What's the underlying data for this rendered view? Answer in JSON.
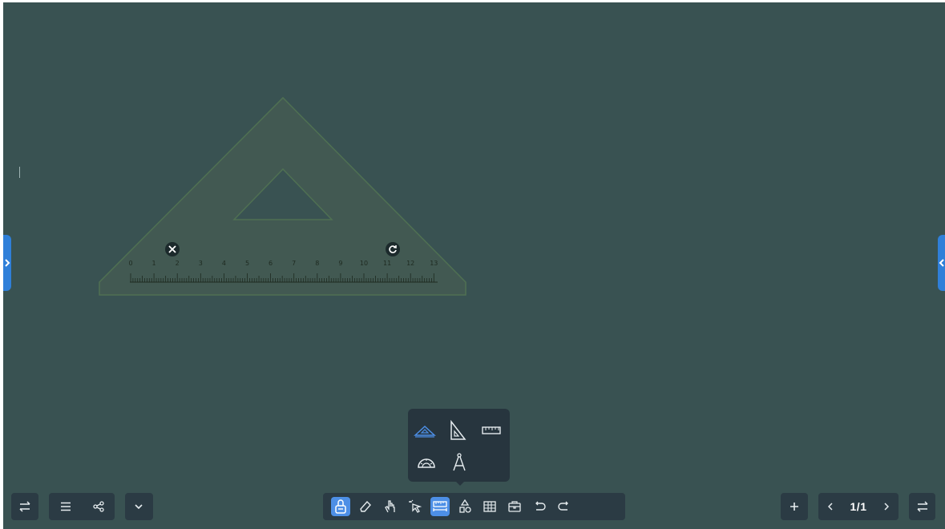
{
  "canvas": {
    "background": "#395252",
    "edge_tab_color": "#2f7fd9"
  },
  "set_square": {
    "ruler_labels": [
      "0",
      "1",
      "2",
      "3",
      "4",
      "5",
      "6",
      "7",
      "8",
      "9",
      "10",
      "11",
      "12",
      "13"
    ],
    "close_icon": "close-icon",
    "rotate_icon": "rotate-icon"
  },
  "toolbar_left": {
    "icons": [
      "swap-icon",
      "menu-icon",
      "share-icon",
      "chevron-down-icon"
    ]
  },
  "toolbar_center": {
    "tools": [
      {
        "name": "pen-tool",
        "active": true
      },
      {
        "name": "eraser-tool",
        "active": false
      },
      {
        "name": "hand-tool",
        "active": false
      },
      {
        "name": "select-tool",
        "active": false
      },
      {
        "name": "ruler-tool",
        "active": true
      },
      {
        "name": "shapes-tool",
        "active": false
      },
      {
        "name": "table-tool",
        "active": false
      },
      {
        "name": "toolbox-tool",
        "active": false
      },
      {
        "name": "undo",
        "active": false
      },
      {
        "name": "redo",
        "active": false
      }
    ],
    "accent_color": "#4d8fe6"
  },
  "ruler_popover": {
    "items": [
      "triangle-ruler-icon",
      "right-triangle-ruler-icon",
      "straight-ruler-icon",
      "protractor-icon",
      "compass-icon"
    ],
    "selected": "triangle-ruler-icon"
  },
  "toolbar_right": {
    "add_icon": "plus-icon",
    "page_indicator": "1/1",
    "prev_icon": "chevron-left-icon",
    "next_icon": "chevron-right-icon",
    "swap_icon": "swap-icon"
  }
}
